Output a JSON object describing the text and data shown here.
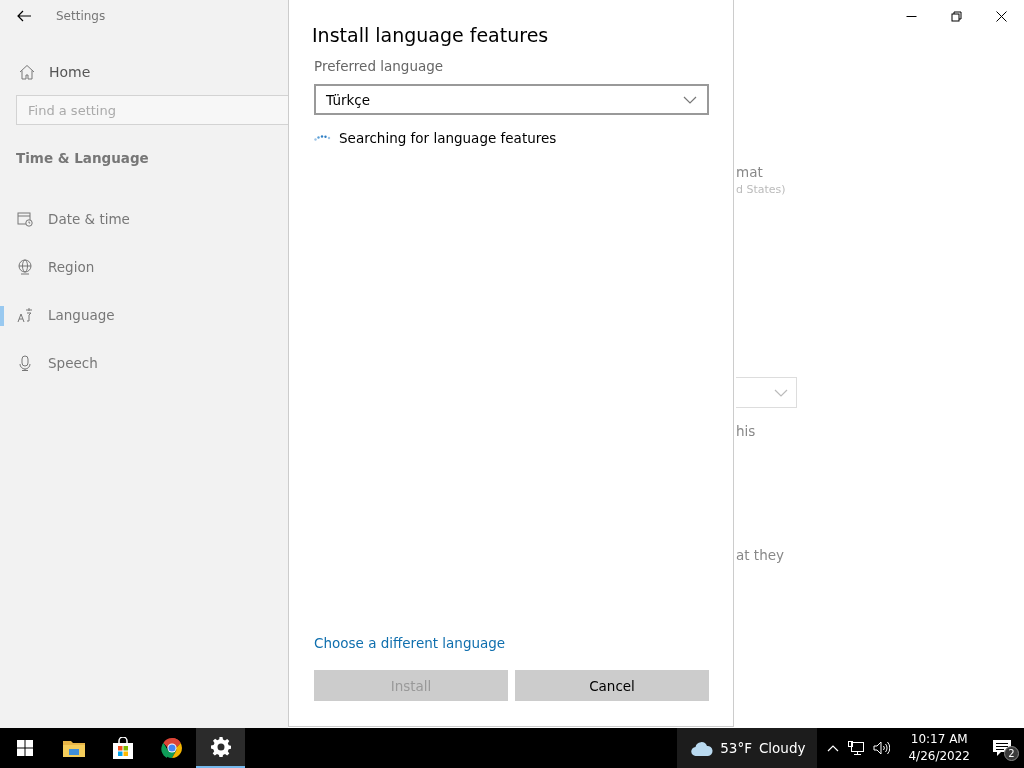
{
  "window": {
    "title": "Settings"
  },
  "sidebar": {
    "home": "Home",
    "search": {
      "placeholder": "Find a setting"
    },
    "section": "Time & Language",
    "items": [
      {
        "label": "Date & time",
        "kind": "calendar",
        "selected": false
      },
      {
        "label": "Region",
        "kind": "globe",
        "selected": false
      },
      {
        "label": "Language",
        "kind": "language",
        "selected": true
      },
      {
        "label": "Speech",
        "kind": "microphone",
        "selected": false
      }
    ]
  },
  "background_fragments": [
    {
      "kind": "text",
      "text": "mat"
    },
    {
      "kind": "secondary",
      "text": "d States)"
    },
    {
      "kind": "dropdown"
    },
    {
      "kind": "text",
      "text": "his"
    },
    {
      "kind": "text",
      "text": "at they"
    }
  ],
  "dialog": {
    "title": "Install language features",
    "field_label": "Preferred language",
    "dropdown": {
      "value": "Türkçe"
    },
    "status": "Searching for language features",
    "link": "Choose a different language",
    "buttons": [
      {
        "label": "Install",
        "disabled": true
      },
      {
        "label": "Cancel",
        "disabled": false
      }
    ]
  },
  "taskbar": {
    "apps": [
      {
        "kind": "explorer",
        "selected": false
      },
      {
        "kind": "store",
        "selected": false
      },
      {
        "kind": "browser",
        "selected": false
      },
      {
        "kind": "settings",
        "selected": true
      }
    ],
    "weather": {
      "temperature": "53°F",
      "condition": "Cloudy"
    },
    "clock": {
      "time": "10:17 AM",
      "date": "4/26/2022"
    },
    "notifications": "2"
  }
}
